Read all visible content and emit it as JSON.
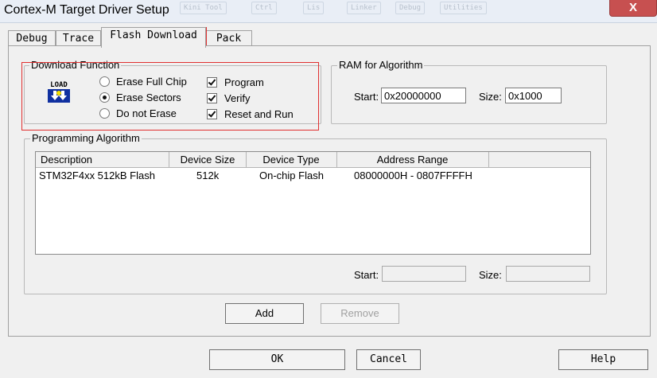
{
  "window": {
    "title": "Cortex-M Target Driver Setup",
    "close_label": "X",
    "ghost_tabs": [
      "Kini Tool",
      "Ctrl",
      "Lis",
      "Linker",
      "Debug",
      "Utilities"
    ]
  },
  "tabs": [
    {
      "label": "Debug",
      "active": false
    },
    {
      "label": "Trace",
      "active": false
    },
    {
      "label": "Flash Download",
      "active": true
    },
    {
      "label": "Pack",
      "active": false
    }
  ],
  "download_function": {
    "title": "Download Function",
    "icon": "load-icon",
    "icon_text": "LOAD",
    "erase_options": [
      {
        "label": "Erase Full Chip",
        "selected": false
      },
      {
        "label": "Erase Sectors",
        "selected": true
      },
      {
        "label": "Do not Erase",
        "selected": false
      }
    ],
    "checks": [
      {
        "label": "Program",
        "checked": true
      },
      {
        "label": "Verify",
        "checked": true
      },
      {
        "label": "Reset and Run",
        "checked": true
      }
    ]
  },
  "ram": {
    "title": "RAM for Algorithm",
    "start_label": "Start:",
    "start_value": "0x20000000",
    "size_label": "Size:",
    "size_value": "0x1000"
  },
  "programming": {
    "title": "Programming Algorithm",
    "columns": [
      "Description",
      "Device Size",
      "Device Type",
      "Address Range"
    ],
    "rows": [
      {
        "description": "STM32F4xx 512kB Flash",
        "size": "512k",
        "type": "On-chip Flash",
        "range": "08000000H - 0807FFFFH"
      }
    ],
    "start_label": "Start:",
    "start_value": "",
    "size_label": "Size:",
    "size_value": ""
  },
  "buttons": {
    "add": "Add",
    "remove": "Remove",
    "ok": "OK",
    "cancel": "Cancel",
    "help": "Help"
  },
  "colors": {
    "highlight_box": "#e03030"
  }
}
